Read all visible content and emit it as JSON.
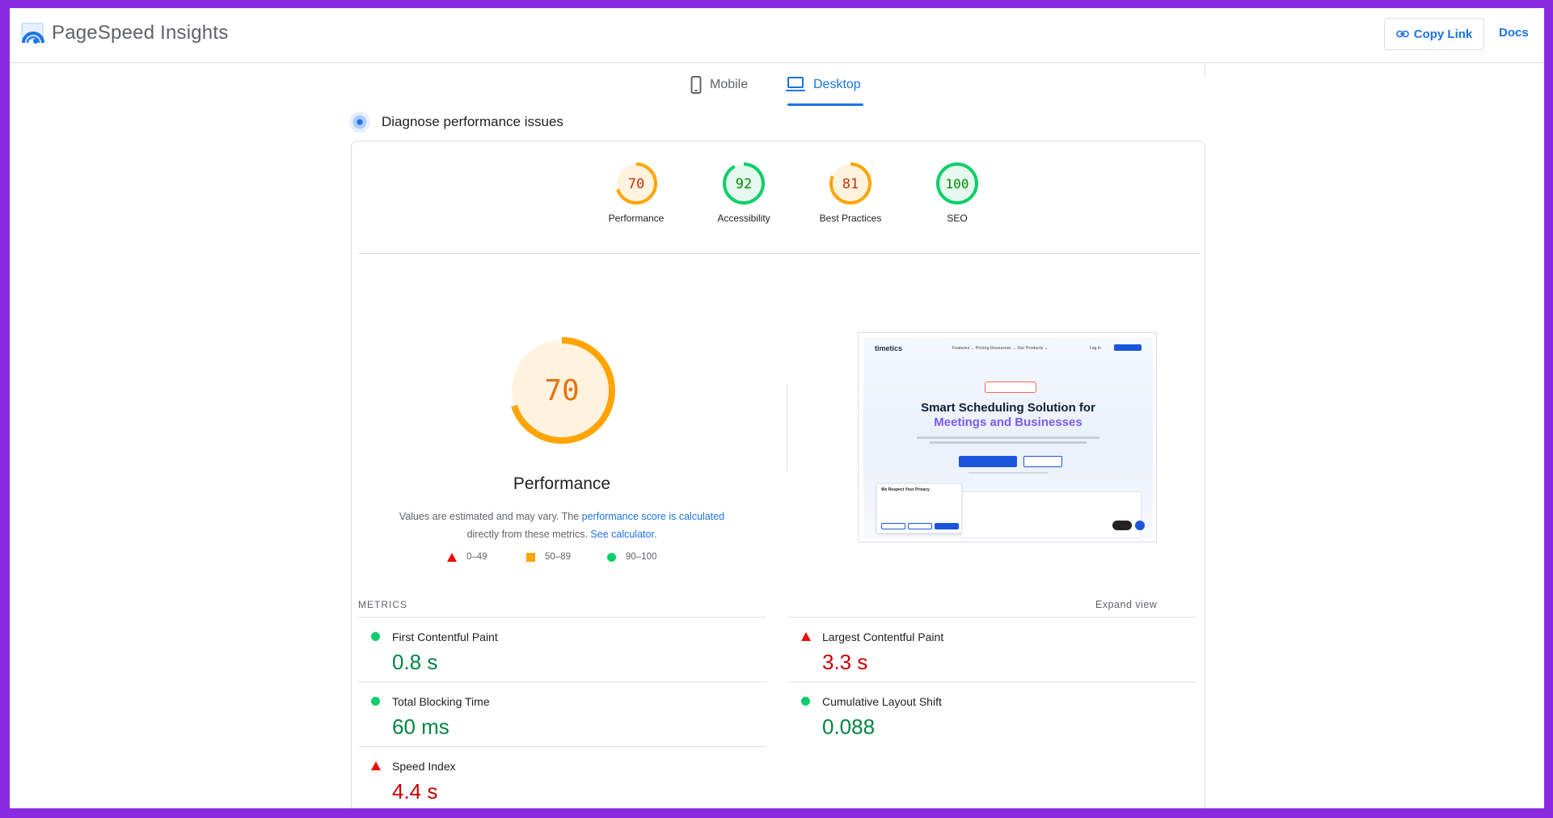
{
  "header": {
    "app_title": "PageSpeed Insights",
    "copy_link_label": "Copy Link",
    "docs_label": "Docs"
  },
  "tabs": [
    {
      "label": "Mobile",
      "active": false
    },
    {
      "label": "Desktop",
      "active": true
    }
  ],
  "diagnose_title": "Diagnose performance issues",
  "categories": [
    {
      "label": "Performance",
      "score": "70",
      "color": "#ffa400",
      "fill": 0.7
    },
    {
      "label": "Accessibility",
      "score": "92",
      "color": "#0cce6b",
      "fill": 0.92
    },
    {
      "label": "Best Practices",
      "score": "81",
      "color": "#ffa400",
      "fill": 0.81
    },
    {
      "label": "SEO",
      "score": "100",
      "color": "#0cce6b",
      "fill": 1.0
    }
  ],
  "main_gauge": {
    "score": "70",
    "label": "Performance",
    "fill": 0.7
  },
  "description": {
    "part1": "Values are estimated and may vary. The ",
    "link1": "performance score is calculated",
    "part2": "directly from these metrics. ",
    "link2": "See calculator",
    "part3": "."
  },
  "legend": [
    {
      "range": "0–49",
      "shape": "triangle",
      "color": "#eb0f00"
    },
    {
      "range": "50–89",
      "shape": "square",
      "color": "#ffa400"
    },
    {
      "range": "90–100",
      "shape": "circle",
      "color": "#0cce6b"
    }
  ],
  "thumbnail": {
    "logo": "timetics",
    "nav": "Features ⌄   Pricing   Resources ⌄   Our Products ⌄",
    "login": "Log in",
    "headline1": "Smart Scheduling Solution for",
    "headline2": "Meetings and Businesses",
    "privacy_title": "We Respect Your Privacy"
  },
  "metrics_label": "METRICS",
  "expand_label": "Expand view",
  "metrics": [
    {
      "name": "First Contentful Paint",
      "value": "0.8 s",
      "status": "pass"
    },
    {
      "name": "Largest Contentful Paint",
      "value": "3.3 s",
      "status": "fail"
    },
    {
      "name": "Total Blocking Time",
      "value": "60 ms",
      "status": "pass"
    },
    {
      "name": "Cumulative Layout Shift",
      "value": "0.088",
      "status": "pass"
    },
    {
      "name": "Speed Index",
      "value": "4.4 s",
      "status": "fail"
    }
  ]
}
